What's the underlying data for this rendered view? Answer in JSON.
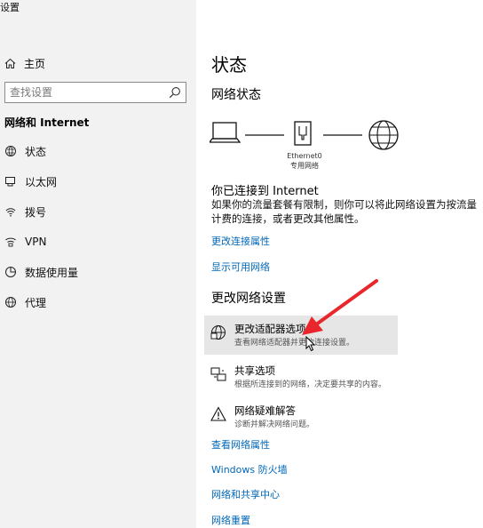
{
  "window": {
    "title": "设置"
  },
  "sidebar": {
    "home_label": "主页",
    "search_placeholder": "查找设置",
    "section_title": "网络和 Internet",
    "items": [
      {
        "label": "状态",
        "icon": "status-icon"
      },
      {
        "label": "以太网",
        "icon": "ethernet-icon"
      },
      {
        "label": "拨号",
        "icon": "dialup-icon"
      },
      {
        "label": "VPN",
        "icon": "vpn-icon"
      },
      {
        "label": "数据使用量",
        "icon": "data-usage-icon"
      },
      {
        "label": "代理",
        "icon": "proxy-icon"
      }
    ]
  },
  "main": {
    "title": "状态",
    "network_status_heading": "网络状态",
    "adapter_name": "Ethernet0",
    "network_name": "专用网络",
    "connected_title": "你已连接到 Internet",
    "connected_desc": "如果你的流量套餐有限制，则你可以将此网络设置为按流量计费的连接，或者更改其他属性。",
    "links_top": [
      "更改连接属性",
      "显示可用网络"
    ],
    "change_settings_heading": "更改网络设置",
    "options": [
      {
        "title": "更改适配器选项",
        "subtitle": "查看网络适配器并更改连接设置。",
        "icon": "adapter-icon"
      },
      {
        "title": "共享选项",
        "subtitle": "根据所连接到的网络，决定要共享的内容。",
        "icon": "sharing-icon"
      },
      {
        "title": "网络疑难解答",
        "subtitle": "诊断并解决网络问题。",
        "icon": "warning-icon"
      }
    ],
    "links_bottom": [
      "查看网络属性",
      "Windows 防火墙",
      "网络和共享中心",
      "网络重置"
    ]
  }
}
